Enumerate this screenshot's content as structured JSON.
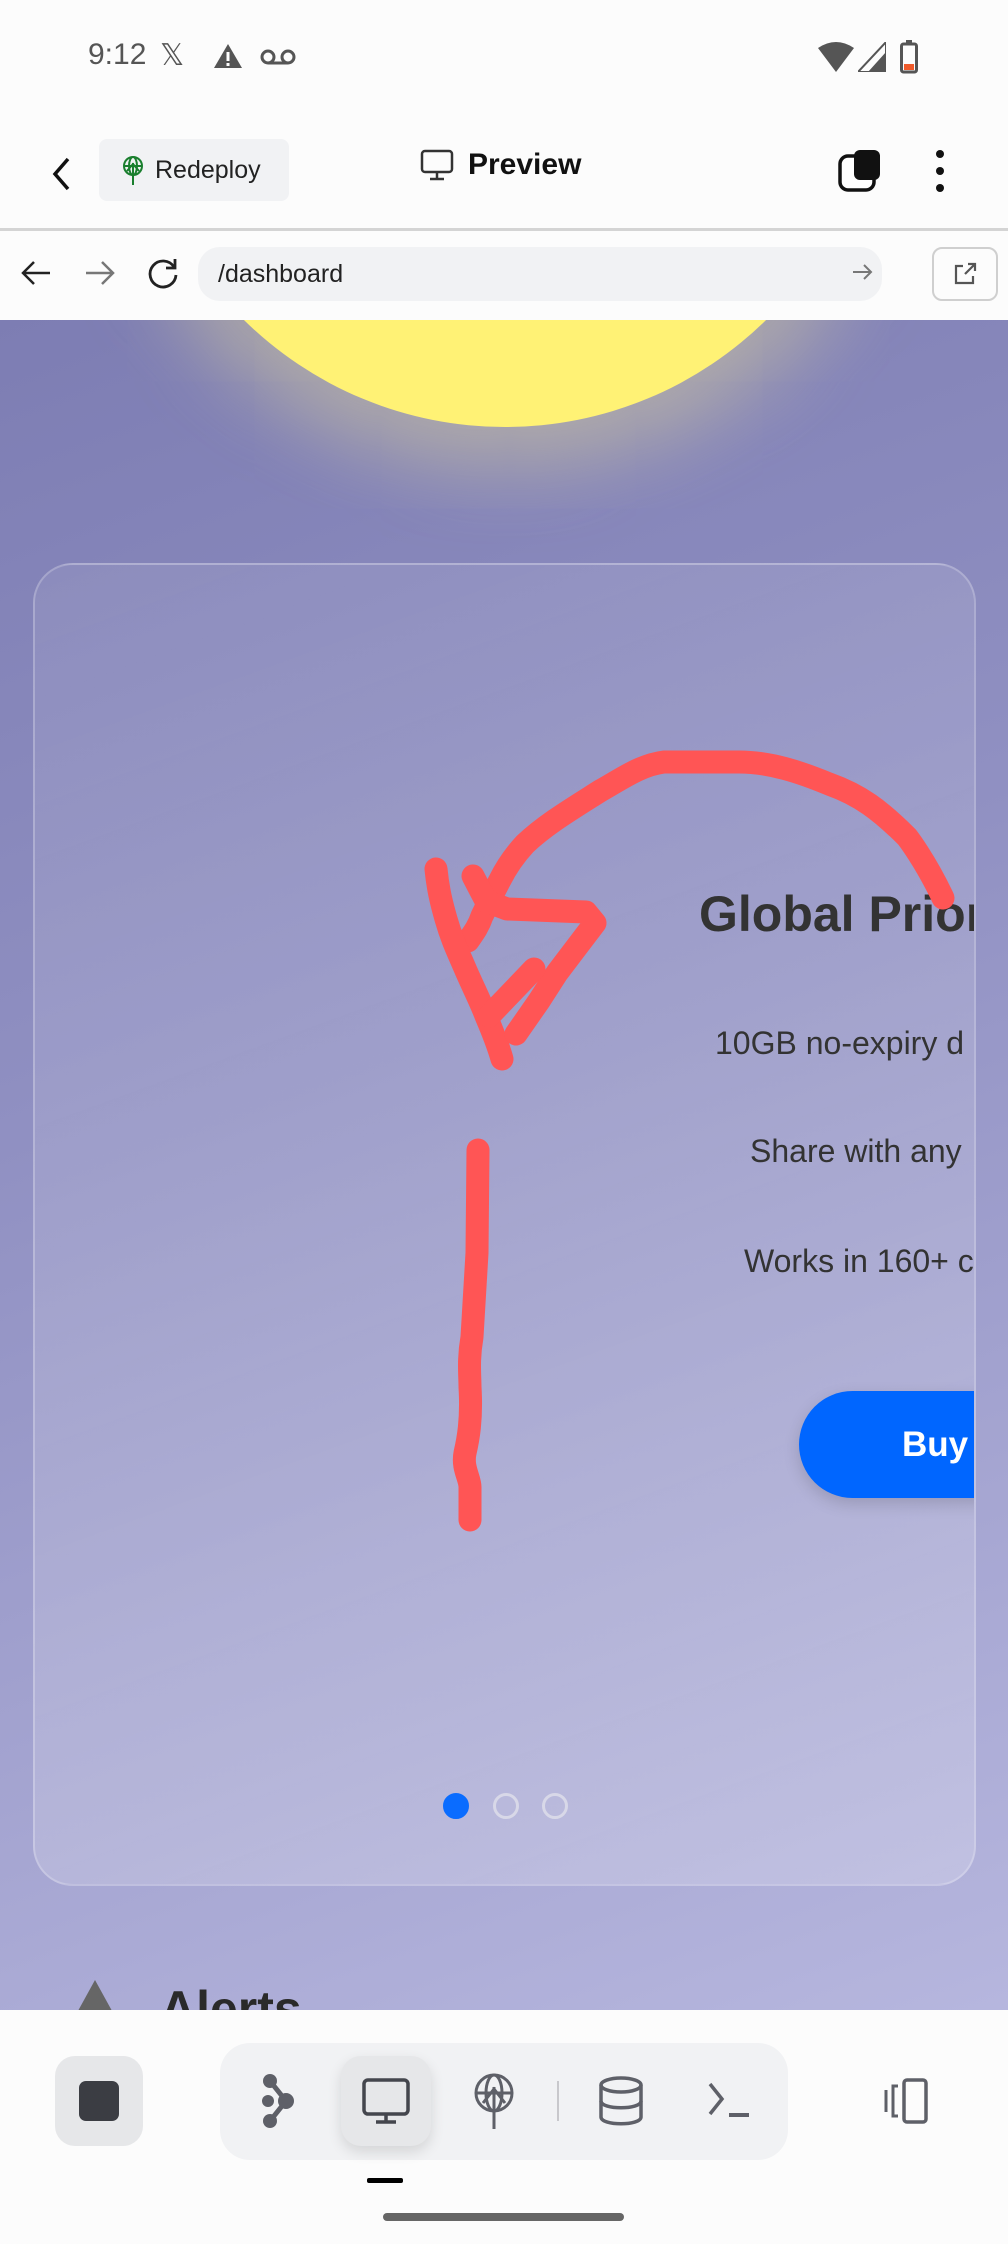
{
  "status_bar": {
    "time": "9:12",
    "icons": [
      "x-logo-icon",
      "warning-icon",
      "voicemail-icon",
      "wifi-icon",
      "signal-icon",
      "battery-low-icon"
    ]
  },
  "header": {
    "back_icon": "chevron-left-icon",
    "redeploy_label": "Redeploy",
    "title": "Preview",
    "tabs_icon": "tabs-icon",
    "menu_icon": "kebab-icon"
  },
  "browser": {
    "url": "/dashboard",
    "back_icon": "arrow-left-icon",
    "forward_icon": "arrow-right-icon",
    "reload_icon": "reload-icon",
    "go_icon": "arrow-right-icon",
    "open_external_icon": "external-link-icon"
  },
  "card": {
    "title": "Global Prior",
    "lines": [
      "10GB no-expiry d",
      "Share with any",
      "Works in 160+ c"
    ],
    "button": "Buy",
    "carousel": {
      "total": 3,
      "active": 1
    }
  },
  "alerts": {
    "heading": "Alerts"
  },
  "annotation_color": "#ff5555",
  "accent_color": "#0066ff",
  "bottom_nav": {
    "items": [
      "stop",
      "graph",
      "preview",
      "deploy",
      "database",
      "terminal",
      "device-toggle"
    ],
    "active": "preview"
  }
}
